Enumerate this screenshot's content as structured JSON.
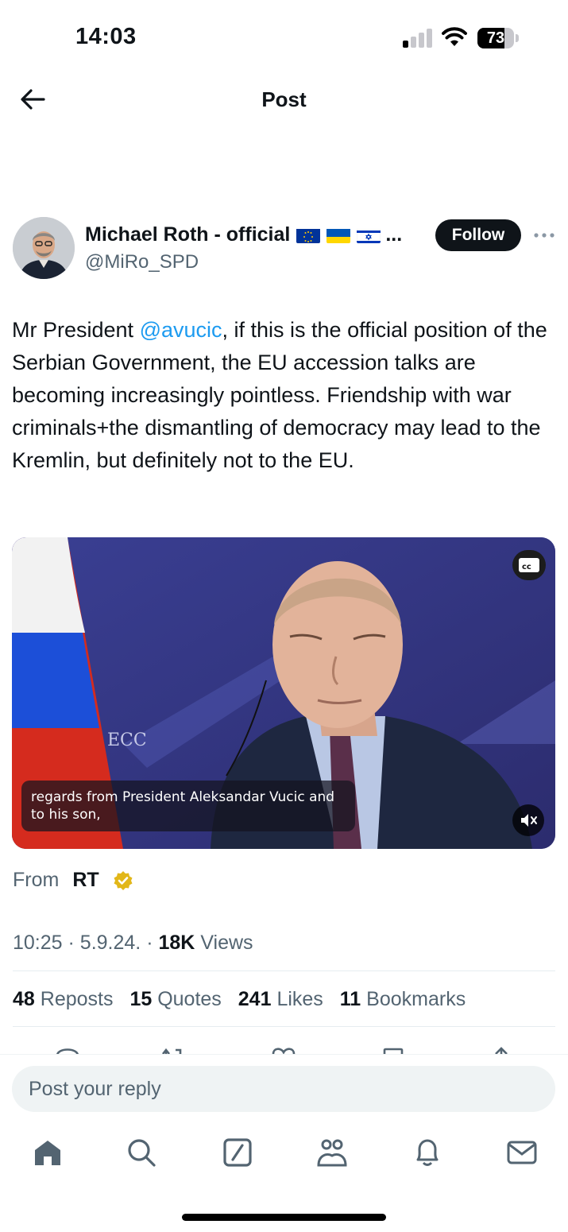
{
  "status_bar": {
    "time": "14:03",
    "battery": "73",
    "battery_level_pct": 73
  },
  "header": {
    "title": "Post"
  },
  "author": {
    "name": "Michael Roth - official",
    "flags": [
      "eu-flag-icon",
      "ukraine-flag-icon",
      "israel-flag-icon"
    ],
    "name_overflow": "...",
    "handle": "@MiRo_SPD",
    "follow_label": "Follow"
  },
  "tweet": {
    "text_before_mention": "Mr President ",
    "mention": "@avucic",
    "text_after_mention": ", if this is the official position of the Serbian Government, the EU accession talks are becoming increasingly pointless. Friendship with war criminals+the dismantling of democracy may lead to the Kremlin, but definitely not to the EU."
  },
  "media": {
    "backdrop_text": "ECC",
    "caption": "regards from President Aleksandar Vucic and to his son,"
  },
  "source": {
    "from_label": "From",
    "name": "RT"
  },
  "meta": {
    "time": "10:25",
    "date": "5.9.24.",
    "views_count": "18K",
    "views_label": "Views",
    "separator": "·"
  },
  "stats": [
    {
      "count": "48",
      "label": "Reposts"
    },
    {
      "count": "15",
      "label": "Quotes"
    },
    {
      "count": "241",
      "label": "Likes"
    },
    {
      "count": "11",
      "label": "Bookmarks"
    }
  ],
  "reply": {
    "placeholder": "Post your reply"
  },
  "colors": {
    "link": "#1d9bf0",
    "text": "#0f1419",
    "secondary": "#536471",
    "verified_gold": "#e2b719"
  },
  "tab_bar": [
    "home-icon",
    "search-icon",
    "compose-icon",
    "communities-icon",
    "notifications-icon",
    "messages-icon"
  ]
}
